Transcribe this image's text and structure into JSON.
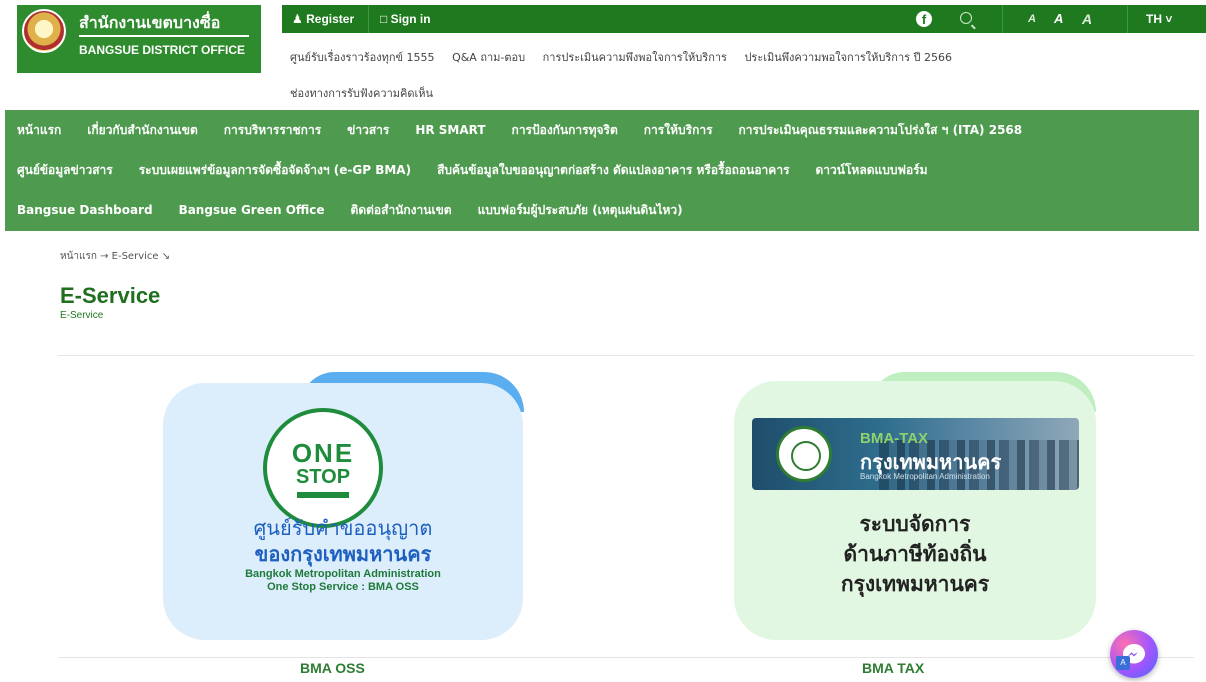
{
  "header": {
    "logo_th": "สำนักงานเขตบางซื่อ",
    "logo_en": "BANGSUE DISTRICT OFFICE",
    "register": "Register",
    "signin": "Sign in",
    "fb": "f",
    "font_sizes": [
      "A",
      "A",
      "A"
    ],
    "lang": "TH ˅",
    "links": [
      "ศูนย์รับเรื่องราวร้องทุกข์ 1555",
      "Q&A ถาม-ตอบ",
      "การประเมินความพึงพอใจการให้บริการ",
      "ประเมินพึงความพอใจการให้บริการ ปี 2566"
    ],
    "link2": "ช่องทางการรับฟังความคิดเห็น"
  },
  "nav": {
    "row1": [
      "หน้าแรก",
      "เกี่ยวกับสำนักงานเขต",
      "การบริหารราชการ",
      "ข่าวสาร",
      "HR SMART",
      "การป้องกันการทุจริต",
      "การให้บริการ",
      "การประเมินคุณธรรมและความโปร่งใส ฯ (ITA) 2568"
    ],
    "row2": [
      "ศูนย์ข้อมูลข่าวสาร",
      "ระบบเผยแพร่ข้อมูลการจัดซื้อจัดจ้างฯ (e-GP BMA)",
      "สืบค้นข้อมูลใบขออนุญาตก่อสร้าง ดัดแปลงอาคาร หรือรื้อถอนอาคาร",
      "ดาวน์โหลดแบบฟอร์ม"
    ],
    "row3": [
      "Bangsue Dashboard",
      "Bangsue Green Office",
      "ติดต่อสำนักงานเขต",
      "แบบฟอร์มผู้ประสบภัย (เหตุแผ่นดินไหว)"
    ]
  },
  "main": {
    "breadcrumb": "หน้าแรก → E-Service ↘",
    "title": "E-Service",
    "subtitle": "E-Service",
    "oss": {
      "logo_top": "ONE",
      "logo_bottom": "STOP",
      "th1": "ศูนย์รับคำขออนุญาต",
      "th2": "ของกรุงเทพมหานคร",
      "en1": "Bangkok Metropolitan Administration",
      "en2": "One Stop Service : BMA OSS",
      "caption": "BMA OSS"
    },
    "tax": {
      "banner1": "BMA-TAX",
      "banner2": "กรุงเทพมหานคร",
      "banner3": "Bangkok Metropolitan Administration",
      "t1": "ระบบจัดการ",
      "t2": "ด้านภาษีท้องถิ่น",
      "t3": "กรุงเทพมหานคร",
      "caption": "BMA TAX"
    }
  },
  "colors": {
    "brand_green": "#1f7a1f",
    "nav_green": "#4e9a4e",
    "oss_bg": "#dcedfb",
    "tax_bg": "#e2f7e2"
  },
  "icons": {
    "register": "user-icon",
    "signin": "lock-icon",
    "facebook": "facebook-icon",
    "search": "search-icon",
    "chat": "messenger-icon"
  }
}
